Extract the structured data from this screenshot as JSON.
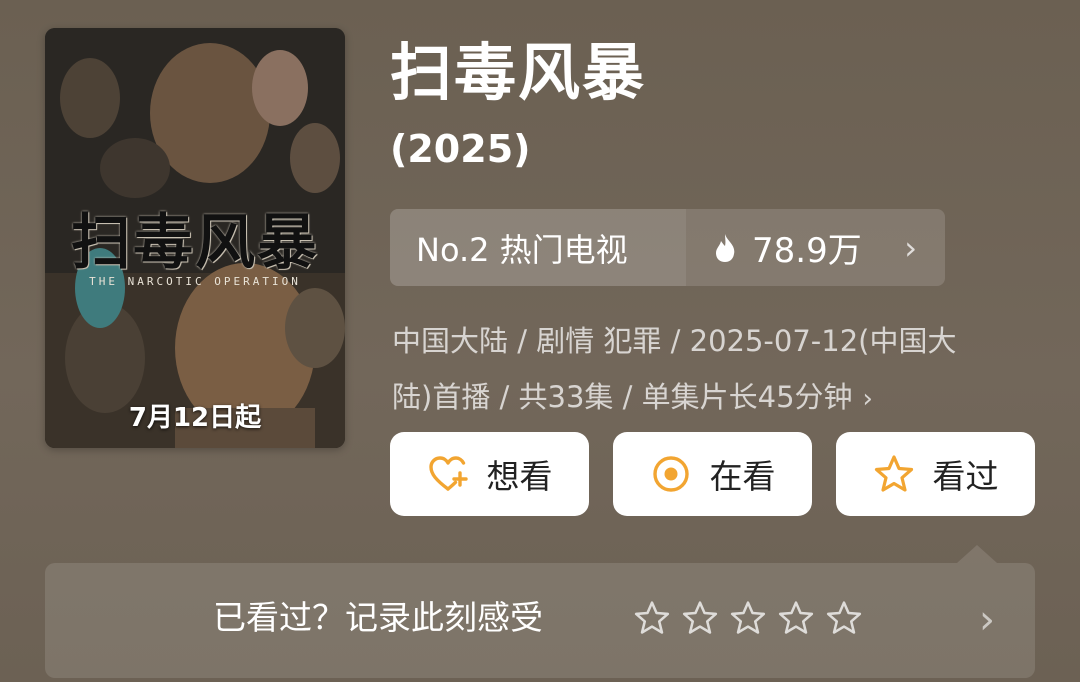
{
  "poster": {
    "title_art": "扫毒风暴",
    "subtitle_art": "THE NARCOTIC OPERATION",
    "date_art": "7月12日起"
  },
  "title": "扫毒风暴",
  "year": "(2025)",
  "rank": {
    "label": "No.2 热门电视",
    "heat": "78.9万",
    "chevron": "›"
  },
  "meta": {
    "line1": "中国大陆 / 剧情 犯罪 / 2025-07-12(中国大",
    "line2": "陆)首播 / 共33集 / 单集片长45分钟",
    "chevron": "›"
  },
  "actions": [
    {
      "label": "想看",
      "icon": "heart-plus-icon"
    },
    {
      "label": "在看",
      "icon": "target-circle-icon"
    },
    {
      "label": "看过",
      "icon": "star-outline-icon"
    }
  ],
  "rating_card": {
    "prompt": "已看过？记录此刻感受",
    "star_count": 5,
    "chevron": "›"
  },
  "colors": {
    "background": "#6f6456",
    "accent": "#f2a531",
    "button_bg": "#ffffff"
  }
}
